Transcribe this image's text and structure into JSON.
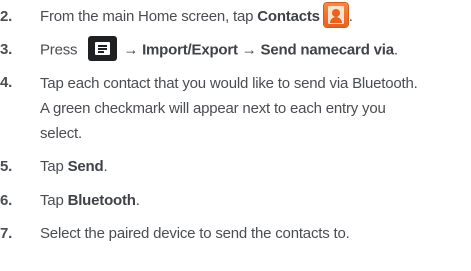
{
  "steps": [
    {
      "num": "2.",
      "parts": [
        "From the main Home screen, tap ",
        "Contacts",
        "."
      ]
    },
    {
      "num": "3.",
      "parts": [
        "Press ",
        "→ Import/Export → Send namecard via",
        "."
      ]
    },
    {
      "num": "4.",
      "lines": [
        "Tap each contact that you would like to send via Bluetooth.",
        "A green checkmark will appear next to each entry you",
        "select."
      ]
    },
    {
      "num": "5.",
      "parts": [
        "Tap ",
        "Send",
        "."
      ]
    },
    {
      "num": "6.",
      "parts": [
        "Tap ",
        "Bluetooth",
        "."
      ]
    },
    {
      "num": "7.",
      "parts": [
        "Select the paired device to send the contacts to."
      ]
    }
  ],
  "icons": {
    "contacts": "contacts-app-icon",
    "menu": "menu-key-icon"
  },
  "colors": {
    "text": "#4a4d52",
    "contacts_icon": "#e8611d",
    "menu_icon": "#1f2022"
  }
}
